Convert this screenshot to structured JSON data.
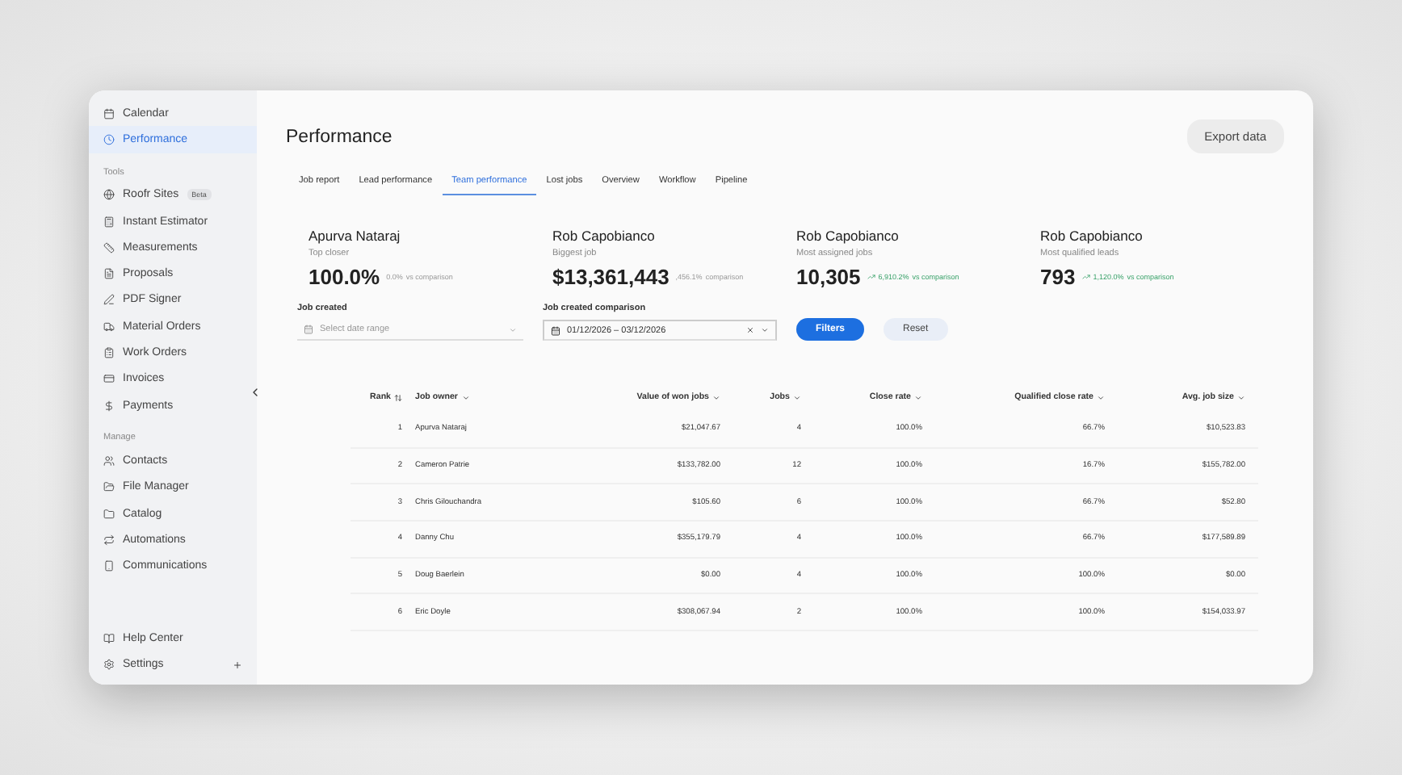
{
  "sidebar": {
    "top_items": [
      {
        "label": "Calendar",
        "selected": false
      },
      {
        "label": "Performance",
        "selected": true
      }
    ],
    "sections": [
      {
        "title": "Tools",
        "items": [
          {
            "label": "Roofr Sites",
            "badge": "Beta"
          },
          {
            "label": "Instant Estimator"
          },
          {
            "label": "Measurements"
          },
          {
            "label": "Proposals"
          },
          {
            "label": "PDF Signer"
          },
          {
            "label": "Material Orders"
          },
          {
            "label": "Work Orders"
          },
          {
            "label": "Invoices"
          },
          {
            "label": "Payments"
          }
        ]
      },
      {
        "title": "Manage",
        "items": [
          {
            "label": "Contacts"
          },
          {
            "label": "File Manager"
          },
          {
            "label": "Catalog"
          },
          {
            "label": "Automations"
          },
          {
            "label": "Communications"
          }
        ]
      }
    ],
    "bottom_items": [
      {
        "label": "Help Center"
      },
      {
        "label": "Settings"
      }
    ]
  },
  "page": {
    "title": "Performance",
    "export_button": "Export data"
  },
  "tabs": [
    {
      "label": "Job report",
      "selected": false
    },
    {
      "label": "Lead performance",
      "selected": false
    },
    {
      "label": "Team performance",
      "selected": true
    },
    {
      "label": "Lost jobs",
      "selected": false
    },
    {
      "label": "Overview",
      "selected": false
    },
    {
      "label": "Workflow",
      "selected": false
    },
    {
      "label": "Pipeline",
      "selected": false
    }
  ],
  "cards": [
    {
      "name": "Apurva Nataraj",
      "caption": "Top closer",
      "value": "100.0%",
      "delta": "0.0%",
      "delta_suffix": "vs comparison",
      "trend": false
    },
    {
      "name": "Rob Capobianco",
      "caption": "Biggest job",
      "value": "$13,361,443",
      "delta": ",456.1%",
      "delta_suffix": "comparison",
      "trend": false
    },
    {
      "name": "Rob Capobianco",
      "caption": "Most assigned jobs",
      "value": "10,305",
      "delta": "6,910.2%",
      "delta_suffix": "vs comparison",
      "trend": true
    },
    {
      "name": "Rob Capobianco",
      "caption": "Most qualified leads",
      "value": "793",
      "delta": "1,120.0%",
      "delta_suffix": "vs comparison",
      "trend": true
    }
  ],
  "filters": {
    "job_created": {
      "label": "Job created",
      "placeholder": "Select date range"
    },
    "comparison": {
      "label": "Job created comparison",
      "value": "01/12/2026 – 03/12/2026"
    },
    "filters_button": "Filters",
    "reset_button": "Reset"
  },
  "table": {
    "columns": [
      "Rank",
      "Job owner",
      "Value of won jobs",
      "Jobs",
      "Close rate",
      "Qualified close rate",
      "Avg. job size"
    ],
    "rows": [
      [
        "1",
        "Apurva Nataraj",
        "$21,047.67",
        "4",
        "100.0%",
        "66.7%",
        "$10,523.83"
      ],
      [
        "2",
        "Cameron Patrie",
        "$133,782.00",
        "12",
        "100.0%",
        "16.7%",
        "$155,782.00"
      ],
      [
        "3",
        "Chris Gilouchandra",
        "$105.60",
        "6",
        "100.0%",
        "66.7%",
        "$52.80"
      ],
      [
        "4",
        "Danny Chu",
        "$355,179.79",
        "4",
        "100.0%",
        "66.7%",
        "$177,589.89"
      ],
      [
        "5",
        "Doug Baerlein",
        "$0.00",
        "4",
        "100.0%",
        "100.0%",
        "$0.00"
      ],
      [
        "6",
        "Eric Doyle",
        "$308,067.94",
        "2",
        "100.0%",
        "100.0%",
        "$154,033.97"
      ]
    ]
  }
}
